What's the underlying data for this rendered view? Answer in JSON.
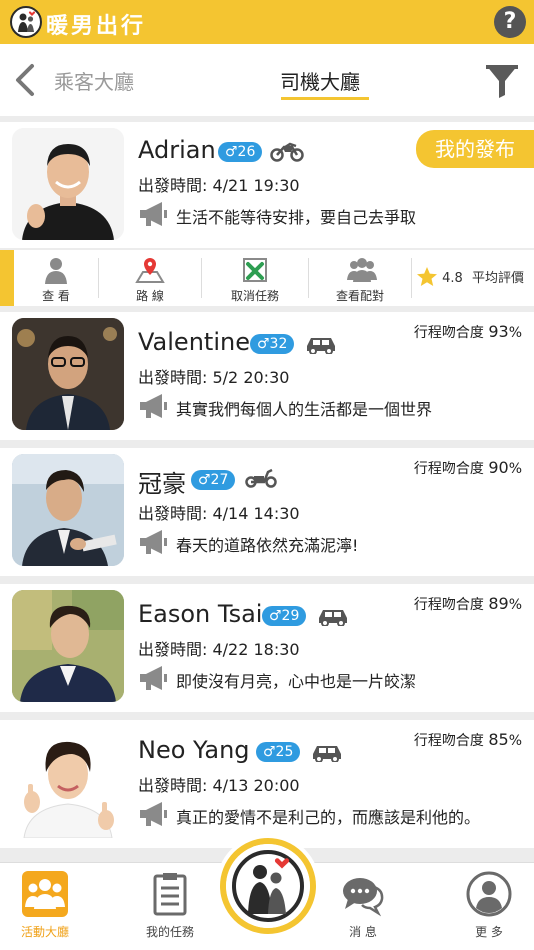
{
  "app": {
    "title": "暖男出行",
    "help_label": "?"
  },
  "tabs": {
    "passenger_label": "乘客大廳",
    "driver_label": "司機大廳"
  },
  "my_post": {
    "tag_label": "我的發布",
    "name": "Adrian",
    "badge": "♂26",
    "vehicle": "motorcycle-icon",
    "depart": "出發時間: 4/21 19:30",
    "message": "生活不能等待安排，要自己去爭取"
  },
  "actions": [
    {
      "label": "查 看",
      "icon": "person-icon"
    },
    {
      "label": "路 線",
      "icon": "map-pin-icon"
    },
    {
      "label": "取消任務",
      "icon": "cancel-task-icon"
    },
    {
      "label": "查看配對",
      "icon": "group-icon"
    }
  ],
  "rating": {
    "value": "4.8",
    "label": "平均評價"
  },
  "drivers": [
    {
      "name": "Valentine",
      "badge": "♂32",
      "vehicle": "car-icon",
      "depart": "出發時間: 5/2  20:30",
      "message": "其實我們每個人的生活都是一個世界",
      "match_label": "行程吻合度",
      "match_value": "93",
      "match_unit": "%"
    },
    {
      "name": "冠豪",
      "badge": "♂27",
      "vehicle": "scooter-icon",
      "depart": "出發時間: 4/14 14:30",
      "message": "春天的道路依然充滿泥濘!",
      "match_label": "行程吻合度",
      "match_value": "90",
      "match_unit": "%"
    },
    {
      "name": "Eason Tsai",
      "badge": "♂29",
      "vehicle": "car-icon",
      "depart": "出發時間: 4/22 18:30",
      "message": "即使沒有月亮，心中也是一片皎潔",
      "match_label": "行程吻合度",
      "match_value": "89",
      "match_unit": "%"
    },
    {
      "name": "Neo Yang",
      "badge": "♂25",
      "vehicle": "car-icon",
      "depart": "出發時間: 4/13 20:00",
      "message": "真正的愛情不是利己的，而應該是利他的。",
      "match_label": "行程吻合度",
      "match_value": "85",
      "match_unit": "%"
    }
  ],
  "nav": [
    {
      "label": "活動大廳",
      "icon": "people-icon",
      "active": true
    },
    {
      "label": "我的任務",
      "icon": "clipboard-icon",
      "active": false
    },
    {
      "label": "消 息",
      "icon": "chat-icon",
      "active": false
    },
    {
      "label": "更 多",
      "icon": "profile-icon",
      "active": false
    }
  ],
  "colors": {
    "brand": "#f4c531",
    "badge": "#2f9be0",
    "active_nav": "#f0a21a"
  }
}
